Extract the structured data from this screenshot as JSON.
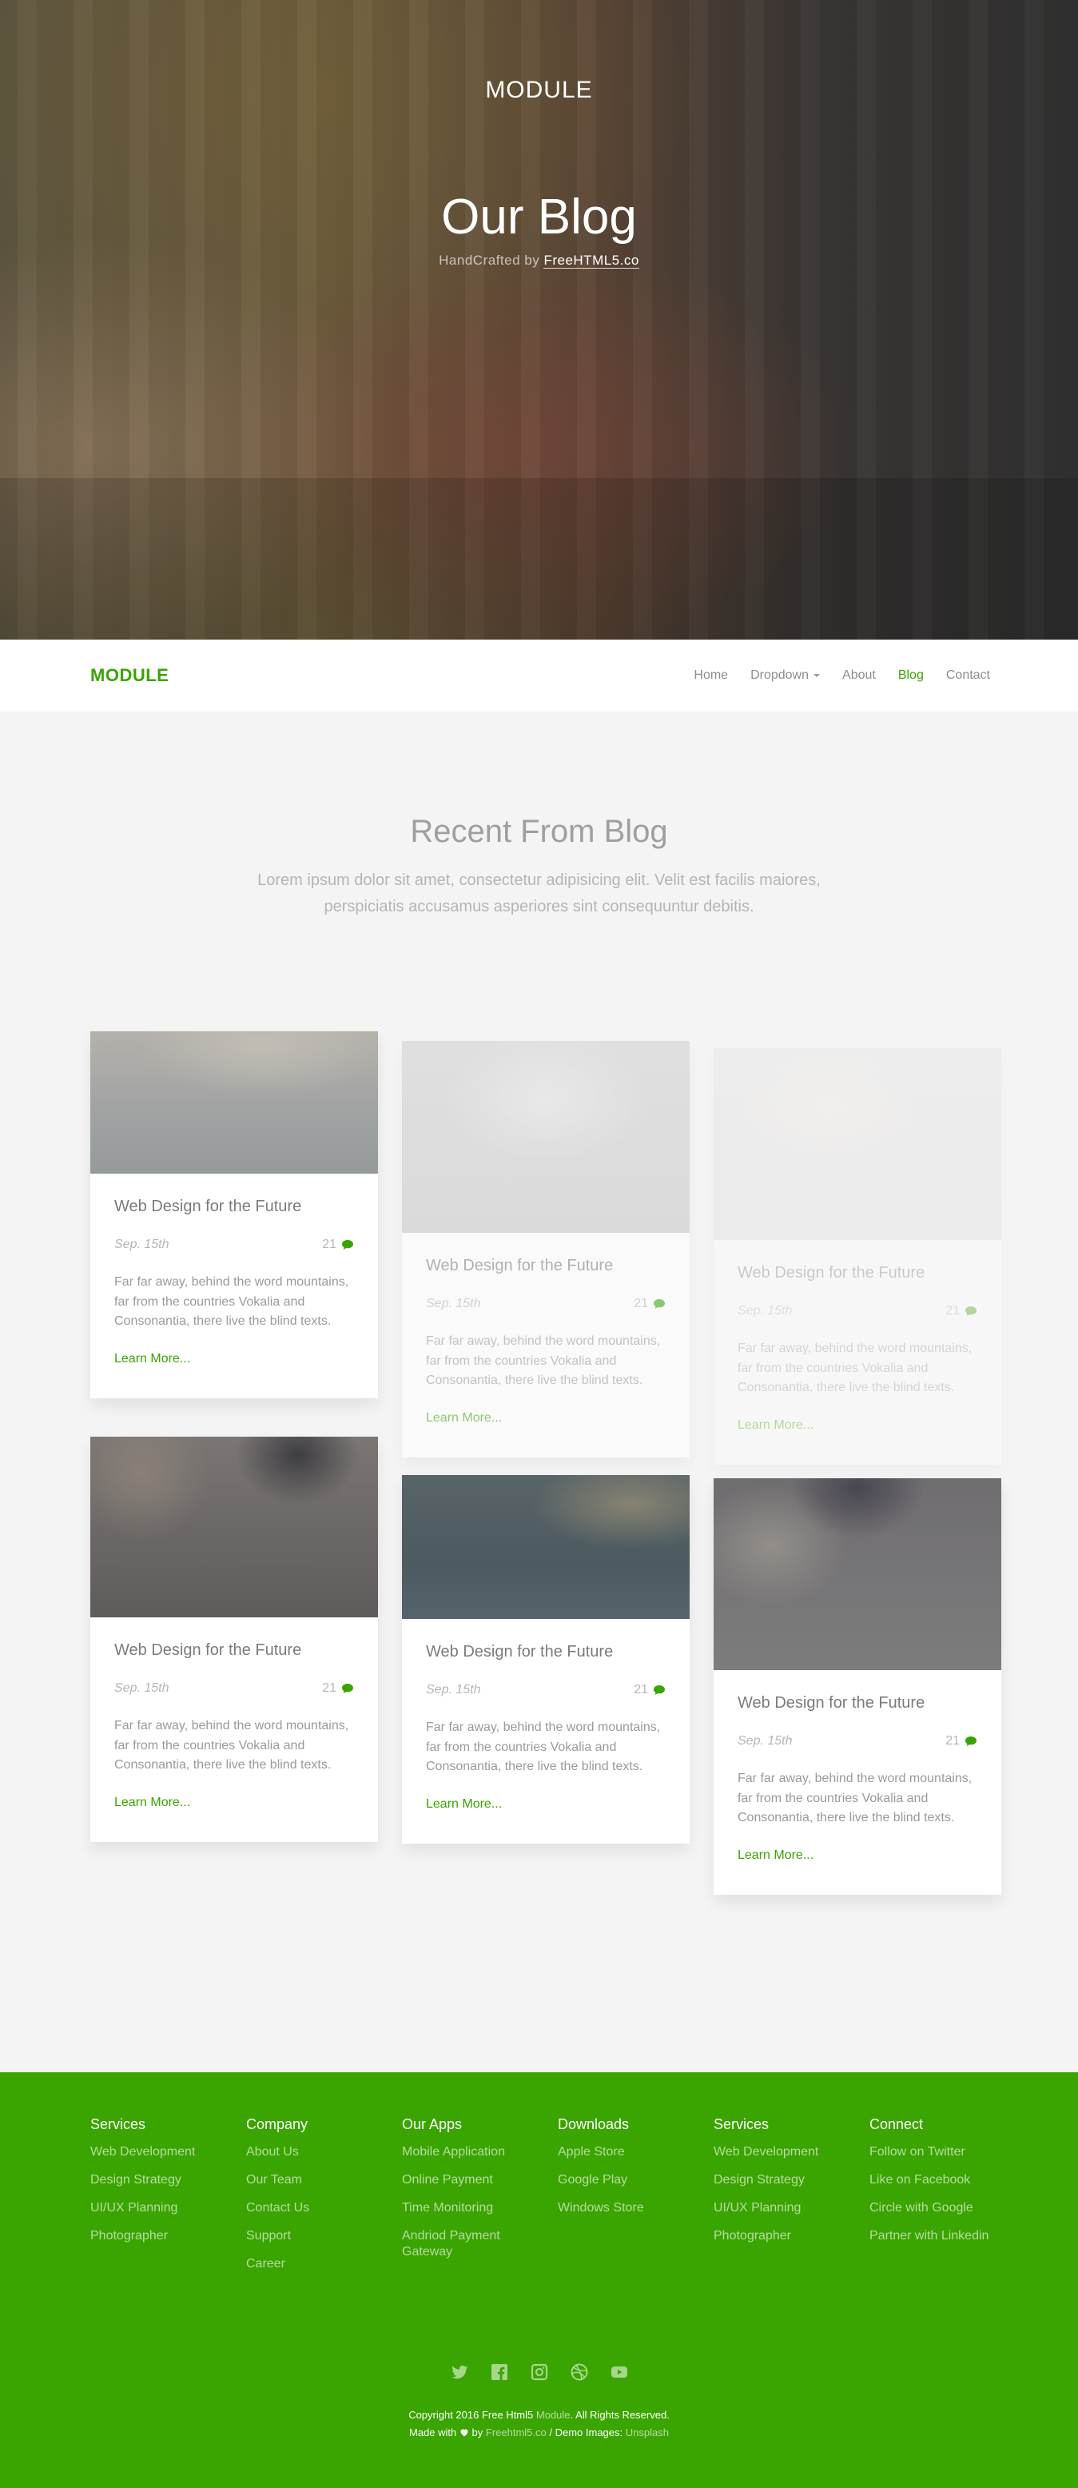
{
  "hero": {
    "brand": "MODULE",
    "title": "Our Blog",
    "sub_prefix": "HandCrafted by ",
    "sub_link": "FreeHTML5.co"
  },
  "nav": {
    "logo": "MODULE",
    "items": [
      {
        "label": "Home",
        "active": false
      },
      {
        "label": "Dropdown",
        "active": false,
        "has_caret": true
      },
      {
        "label": "About",
        "active": false
      },
      {
        "label": "Blog",
        "active": true
      },
      {
        "label": "Contact",
        "active": false
      }
    ]
  },
  "blog": {
    "title": "Recent From Blog",
    "intro": "Lorem ipsum dolor sit amet, consectetur adipisicing elit. Velit est facilis maiores, perspiciatis accusamus asperiores sint consequuntur debitis."
  },
  "posts": [
    {
      "title": "Web Design for the Future",
      "date": "Sep. 15th",
      "comments": "21",
      "excerpt": "Far far away, behind the word mountains, far from the countries Vokalia and Consonantia, there live the blind texts.",
      "more": "Learn More..."
    },
    {
      "title": "Web Design for the Future",
      "date": "Sep. 15th",
      "comments": "21",
      "excerpt": "Far far away, behind the word mountains, far from the countries Vokalia and Consonantia, there live the blind texts.",
      "more": "Learn More..."
    },
    {
      "title": "Web Design for the Future",
      "date": "Sep. 15th",
      "comments": "21",
      "excerpt": "Far far away, behind the word mountains, far from the countries Vokalia and Consonantia, there live the blind texts.",
      "more": "Learn More..."
    },
    {
      "title": "Web Design for the Future",
      "date": "Sep. 15th",
      "comments": "21",
      "excerpt": "Far far away, behind the word mountains, far from the countries Vokalia and Consonantia, there live the blind texts.",
      "more": "Learn More..."
    },
    {
      "title": "Web Design for the Future",
      "date": "Sep. 15th",
      "comments": "21",
      "excerpt": "Far far away, behind the word mountains, far from the countries Vokalia and Consonantia, there live the blind texts.",
      "more": "Learn More..."
    },
    {
      "title": "Web Design for the Future",
      "date": "Sep. 15th",
      "comments": "21",
      "excerpt": "Far far away, behind the word mountains, far from the countries Vokalia and Consonantia, there live the blind texts.",
      "more": "Learn More..."
    }
  ],
  "footer": {
    "columns": [
      {
        "title": "Services",
        "links": [
          "Web Development",
          "Design Strategy",
          "UI/UX Planning",
          "Photographer"
        ]
      },
      {
        "title": "Company",
        "links": [
          "About Us",
          "Our Team",
          "Contact Us",
          "Support",
          "Career"
        ]
      },
      {
        "title": "Our Apps",
        "links": [
          "Mobile Application",
          "Online Payment",
          "Time Monitoring",
          "Andriod Payment Gateway"
        ]
      },
      {
        "title": "Downloads",
        "links": [
          "Apple Store",
          "Google Play",
          "Windows Store"
        ]
      },
      {
        "title": "Services",
        "links": [
          "Web Development",
          "Design Strategy",
          "UI/UX Planning",
          "Photographer"
        ]
      },
      {
        "title": "Connect",
        "links": [
          "Follow on Twitter",
          "Like on Facebook",
          "Circle with Google",
          "Partner with Linkedin"
        ]
      }
    ],
    "social_icons": [
      "twitter-icon",
      "facebook-icon",
      "instagram-icon",
      "dribbble-icon",
      "youtube-icon"
    ],
    "copyright_1": "Copyright 2016 Free Html5",
    "copyright_brand": "Module",
    "copyright_2": ". All Rights Reserved.",
    "made_with": "Made with",
    "by": "by",
    "made_link": "Freehtml5.co",
    "demo_images": "/ Demo Images:",
    "demo_link": "Unsplash"
  },
  "colors": {
    "accent": "#3aa400",
    "page_bg": "#f4f4f4"
  }
}
